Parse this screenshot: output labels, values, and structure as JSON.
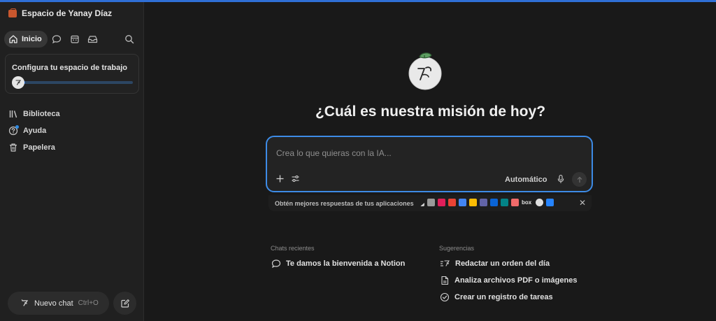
{
  "workspace": {
    "name": "Espacio de Yanay Díaz",
    "icon": "briefcase-icon",
    "icon_color": "#c9572e"
  },
  "nav": {
    "home_label": "Inicio",
    "icons": [
      "home-icon",
      "chat-bubble-icon",
      "calendar-icon",
      "inbox-icon",
      "search-icon"
    ]
  },
  "setup": {
    "title": "Configura tu espacio de trabajo",
    "progress": 0.05
  },
  "sidebar": {
    "items": [
      {
        "label": "Biblioteca",
        "icon": "library-icon"
      },
      {
        "label": "Ayuda",
        "icon": "help-icon"
      },
      {
        "label": "Papelera",
        "icon": "trash-icon"
      }
    ]
  },
  "new_chat": {
    "label": "Nuevo chat",
    "shortcut": "Ctrl+O"
  },
  "main": {
    "headline": "¿Cuál es nuestra misión de hoy?"
  },
  "composer": {
    "placeholder": "Crea lo que quieras con la IA...",
    "mode": "Automático",
    "accent": "#3d8be6"
  },
  "apps_banner": {
    "text": "Obtén mejores respuestas de tus aplicaciones",
    "box_label": "box",
    "apps": [
      {
        "name": "send-app-icon",
        "color": "#d0d0d0"
      },
      {
        "name": "calendar-app-icon",
        "color": "#9a9a9a"
      },
      {
        "name": "slack-icon",
        "color": "#e01e5a"
      },
      {
        "name": "gmail-icon",
        "color": "#ea4335"
      },
      {
        "name": "google-calendar-icon",
        "color": "#4285f4"
      },
      {
        "name": "google-drive-icon",
        "color": "#fbbc04"
      },
      {
        "name": "teams-icon",
        "color": "#6264a7"
      },
      {
        "name": "outlook-icon",
        "color": "#0a64d6"
      },
      {
        "name": "sharepoint-icon",
        "color": "#038387"
      },
      {
        "name": "asana-icon",
        "color": "#f06a6a"
      },
      {
        "name": "box-icon",
        "color": "#e0e0e0"
      },
      {
        "name": "github-icon",
        "color": "#e0e0e0"
      },
      {
        "name": "jira-icon",
        "color": "#2684ff"
      }
    ]
  },
  "recent": {
    "title": "Chats recientes",
    "items": [
      {
        "label": "Te damos la bienvenida a Notion"
      }
    ]
  },
  "suggestions": {
    "title": "Sugerencias",
    "items": [
      {
        "label": "Redactar un orden del día"
      },
      {
        "label": "Analiza archivos PDF o imágenes"
      },
      {
        "label": "Crear un registro de tareas"
      }
    ]
  }
}
